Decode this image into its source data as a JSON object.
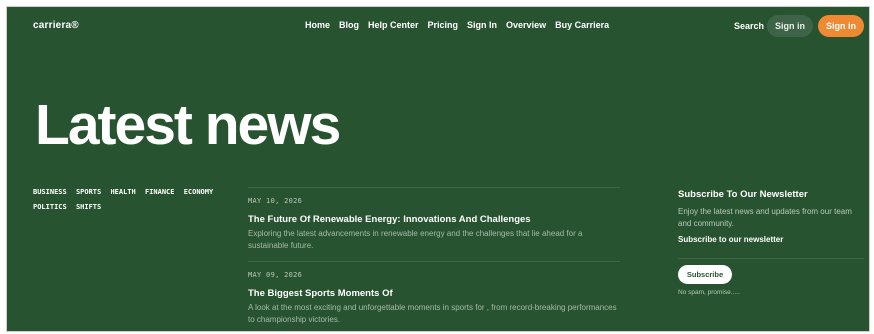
{
  "brand": {
    "logo": "carriera®"
  },
  "nav": {
    "items": [
      "Home",
      "Blog",
      "Help Center",
      "Pricing",
      "Sign In",
      "Overview",
      "Buy Carriera"
    ],
    "search": "Search",
    "signin_ghost": "Sign in",
    "signin_primary": "Sign in"
  },
  "hero": {
    "title": "Latest news"
  },
  "categories": {
    "row1": [
      "BUSINESS",
      "SPORTS",
      "HEALTH",
      "FINANCE",
      "ECONOMY"
    ],
    "row2": [
      "POLITICS",
      "SHIFTS"
    ]
  },
  "articles": [
    {
      "date": "MAY 10, 2026",
      "title": "The Future Of Renewable Energy: Innovations And Challenges",
      "excerpt": "Exploring the latest advancements in renewable energy and the challenges that lie ahead for a sustainable future."
    },
    {
      "date": "MAY 09, 2026",
      "title": "The Biggest Sports Moments Of",
      "excerpt": "A look at the most exciting and unforgettable moments in sports for , from record-breaking performances to championship victories."
    }
  ],
  "newsletter": {
    "title": "Subscribe To Our Newsletter",
    "description": "Enjoy the latest news and updates from our team and community.",
    "link": "Subscribe to our newsletter",
    "button": "Subscribe",
    "note": "No spam, promise....."
  },
  "colors": {
    "background": "#285330",
    "accent": "#ef8a33",
    "text": "#ffffff"
  }
}
